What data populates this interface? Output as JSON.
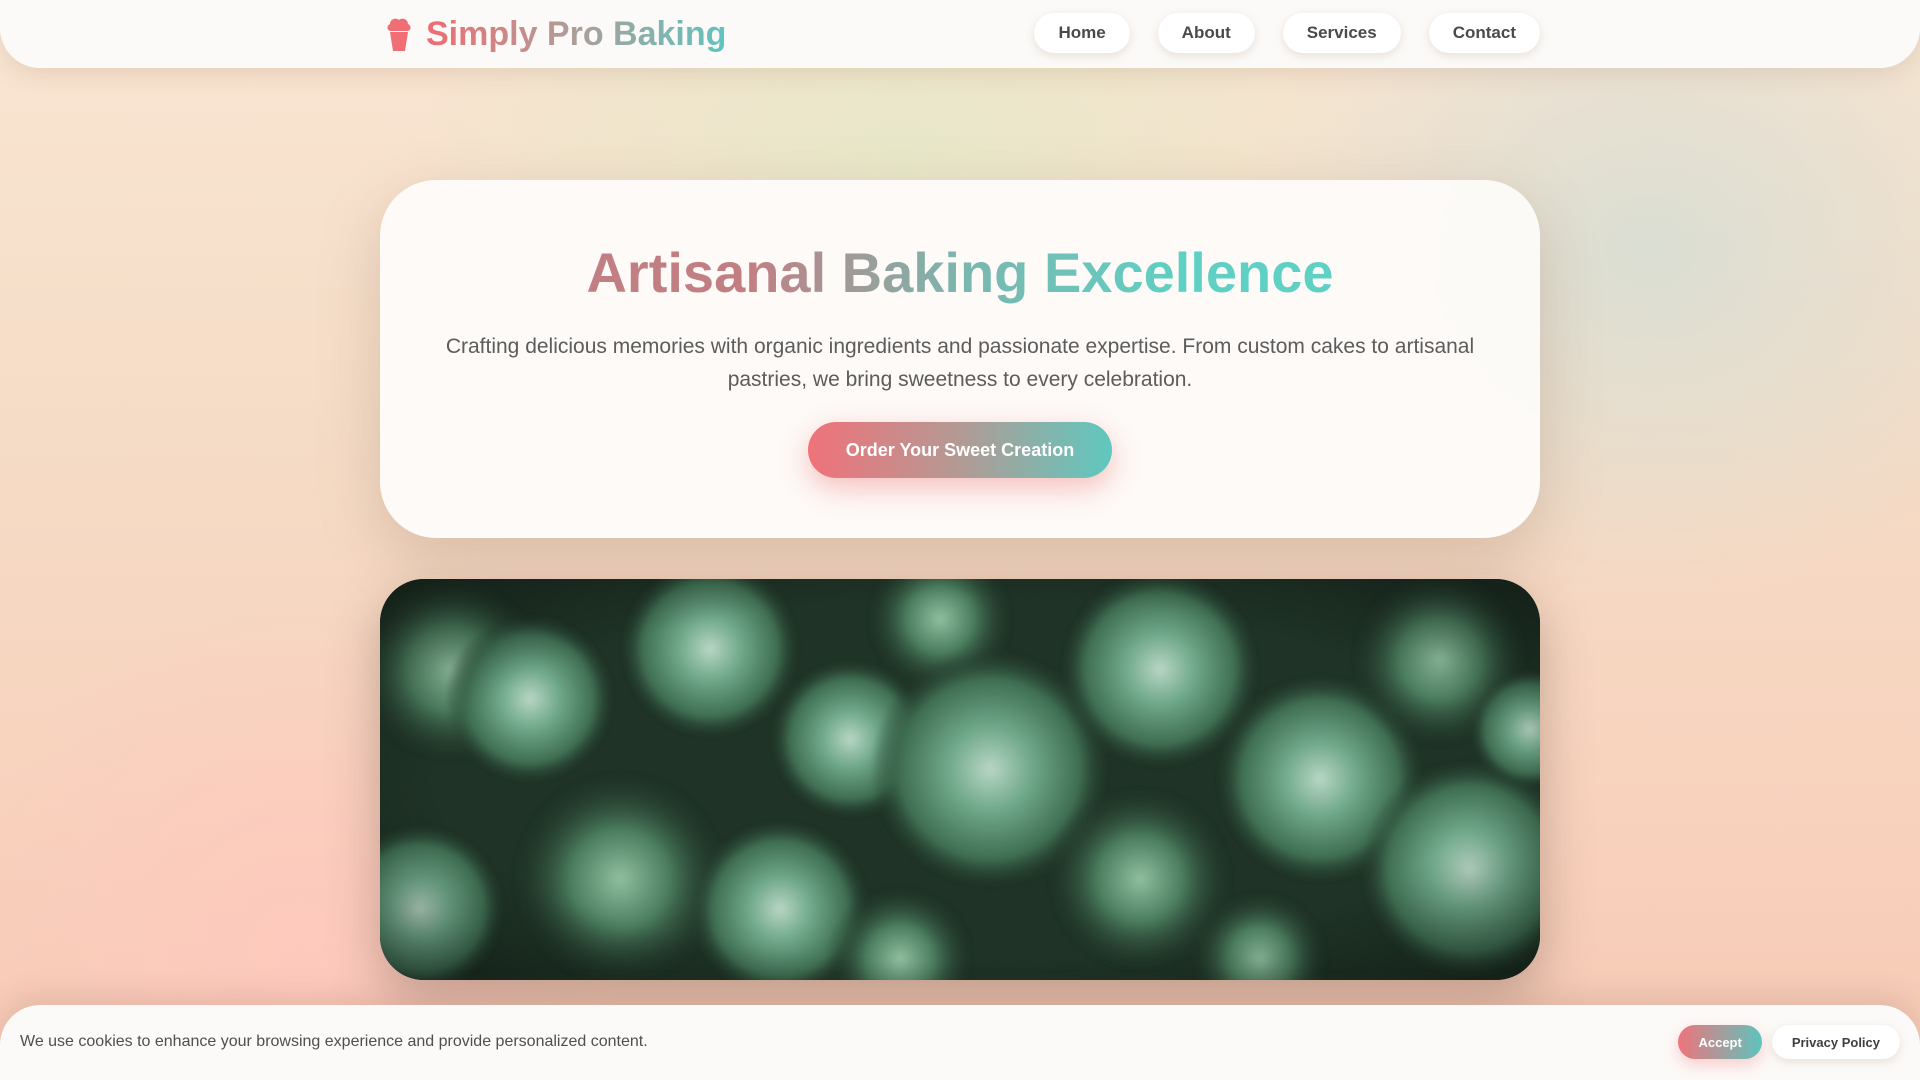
{
  "header": {
    "brand_icon": "cupcake-icon",
    "brand_name": "Simply Pro Baking",
    "nav": [
      {
        "label": "Home"
      },
      {
        "label": "About"
      },
      {
        "label": "Services"
      },
      {
        "label": "Contact"
      }
    ]
  },
  "hero": {
    "title": "Artisanal Baking Excellence",
    "subtitle": "Crafting delicious memories with organic ingredients and passionate expertise. From custom cakes to artisanal pastries, we bring sweetness to every celebration.",
    "cta_label": "Order Your Sweet Creation"
  },
  "cookie_banner": {
    "message": "We use cookies to enhance your browsing experience and provide personalized content.",
    "accept_label": "Accept",
    "policy_label": "Privacy Policy"
  },
  "colors": {
    "accent_coral": "#ef6f74",
    "accent_teal": "#5fc8be",
    "text_gray": "#5c5c5c"
  }
}
